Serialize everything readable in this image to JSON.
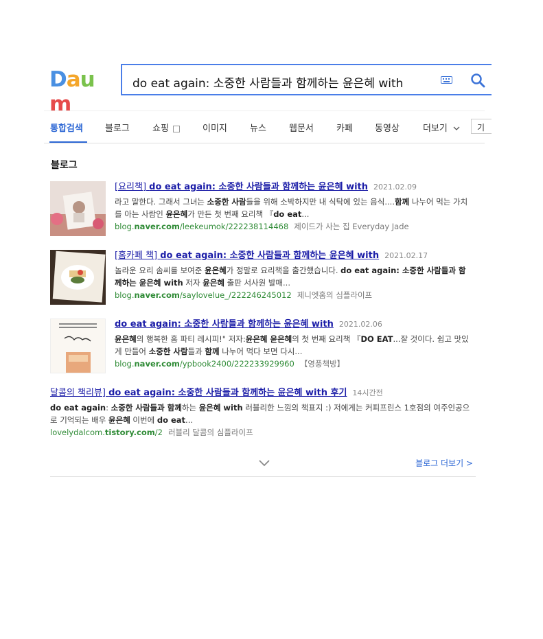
{
  "logo": {
    "text": "Daum",
    "letters": [
      "D",
      "a",
      "u",
      "m"
    ],
    "colors": [
      "#4a90e2",
      "#f4a62a",
      "#7ac24c",
      "#e64a4a"
    ]
  },
  "search": {
    "value": "do eat again: 소중한 사람들과 함께하는 윤은혜 with"
  },
  "tabs": [
    {
      "label": "통합검색",
      "active": true
    },
    {
      "label": "블로그"
    },
    {
      "label": "쇼핑"
    },
    {
      "label": "이미지"
    },
    {
      "label": "뉴스"
    },
    {
      "label": "웹문서"
    },
    {
      "label": "카페"
    },
    {
      "label": "동영상"
    },
    {
      "label": "더보기"
    },
    {
      "label": "기"
    }
  ],
  "section_title": "블로그",
  "results": [
    {
      "title_prefix": "[요리책] ",
      "title_main": "do eat again: 소중한 사람들과 함께하는 윤은혜 with",
      "date": "2021.02.09",
      "desc": [
        {
          "t": "라고 말한다. 그래서 그녀는 "
        },
        {
          "t": "소중한 사람",
          "b": true
        },
        {
          "t": "들을 위해 소박하지만 내 식탁에 있는 음식...."
        },
        {
          "t": "함께",
          "b": true
        },
        {
          "t": " 나누어 먹는 가치를 아는 사람인 "
        },
        {
          "t": "윤은혜",
          "b": true
        },
        {
          "t": "가 만든 첫 번째 요리책 『"
        },
        {
          "t": "do eat",
          "b": true
        },
        {
          "t": "..."
        }
      ],
      "url_prefix": "blog.",
      "url_bold": "naver.com",
      "url_suffix": "/leekeumok/222238114468",
      "source": "제이드가 사는 집 Everyday Jade"
    },
    {
      "title_prefix": "[홈카페 책] ",
      "title_main": "do eat again: 소중한 사람들과 함께하는 윤은혜 with",
      "date": "2021.02.17",
      "desc": [
        {
          "t": "놀라운 요리 솜씨를 보여준 "
        },
        {
          "t": "윤은혜",
          "b": true
        },
        {
          "t": "가 정말로 요리책을 출간했습니다. "
        },
        {
          "t": "do eat again: 소중한 사람들과 함께하는 윤은혜 with",
          "b": true
        },
        {
          "t": " 저자 "
        },
        {
          "t": "윤은혜",
          "b": true
        },
        {
          "t": " 출판 서사원 발매..."
        }
      ],
      "url_prefix": "blog.",
      "url_bold": "naver.com",
      "url_suffix": "/saylovelue_/222246245012",
      "source": "제니엣홈의 심플라이프"
    },
    {
      "title_prefix": "",
      "title_main": "do eat again: 소중한 사람들과 함께하는 윤은혜 with",
      "date": "2021.02.06",
      "desc": [
        {
          "t": "윤은혜",
          "b": true
        },
        {
          "t": "의 행복한 홈 파티 레시피!\" 저자:"
        },
        {
          "t": "윤은혜 윤은혜",
          "b": true
        },
        {
          "t": "의 첫 번째 요리책 『"
        },
        {
          "t": "DO EAT",
          "b": true
        },
        {
          "t": "...잘 것이다. 쉽고 맛있게 만들어 "
        },
        {
          "t": "소중한 사람",
          "b": true
        },
        {
          "t": "들과 "
        },
        {
          "t": "함께",
          "b": true
        },
        {
          "t": " 나누어 먹다 보면 다시..."
        }
      ],
      "url_prefix": "blog.",
      "url_bold": "naver.com",
      "url_suffix": "/ypbook2400/222233929960",
      "source": "【영풍책방】"
    },
    {
      "title_prefix": "달콤의 책리뷰] ",
      "title_main": "do eat again: 소중한 사람들과 함께하는 윤은혜 with 후기",
      "date": "14시간전",
      "desc": [
        {
          "t": "do eat again",
          "b": true
        },
        {
          "t": ": "
        },
        {
          "t": "소중한 사람들과 함께",
          "b": true
        },
        {
          "t": "하는 "
        },
        {
          "t": "윤은혜 with",
          "b": true
        },
        {
          "t": " 러블리한 느낌의 책표지 :) 저에게는 커피프린스 1호점의 여주인공으로 기억되는 배우 "
        },
        {
          "t": "윤은혜",
          "b": true
        },
        {
          "t": " 이번에 "
        },
        {
          "t": "do eat",
          "b": true
        },
        {
          "t": "..."
        }
      ],
      "url_prefix": "lovelydalcom.",
      "url_bold": "tistory.com",
      "url_suffix": "/2",
      "source": "러블리 달콤의 심플라이프"
    }
  ],
  "blog_more": "블로그 더보기 >"
}
